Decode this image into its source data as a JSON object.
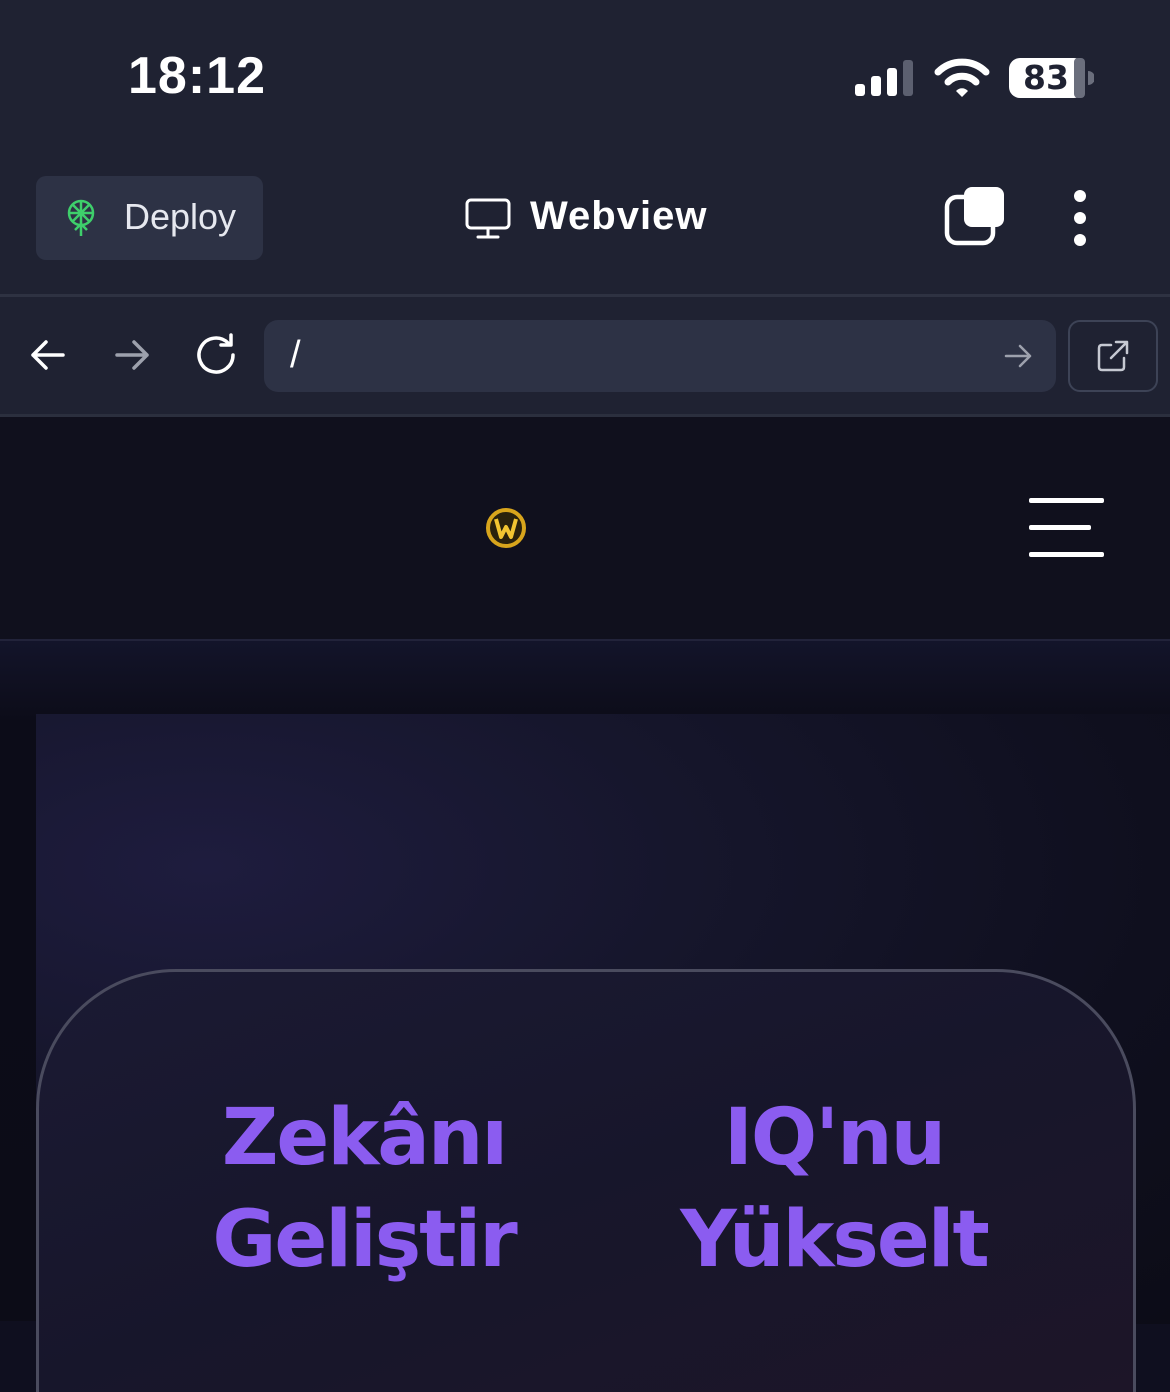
{
  "status_bar": {
    "time": "18:12",
    "battery": "83",
    "icons": [
      "cellular-signal-icon",
      "wifi-icon",
      "battery-icon"
    ]
  },
  "top_bar": {
    "deploy_label": "Deploy",
    "deploy_icon": "deploy-antenna-icon",
    "title": "Webview",
    "title_icon": "monitor-icon",
    "tabs_icon": "tabs-icon",
    "menu_icon": "more-vertical-icon",
    "accent_color": "#3ecf6b"
  },
  "nav_bar": {
    "url": "/",
    "icons": [
      "back-arrow-icon",
      "forward-arrow-icon",
      "reload-icon",
      "go-arrow-icon",
      "open-external-icon"
    ]
  },
  "site": {
    "logo_icon": "brand-logo-icon",
    "menu_icon": "hamburger-menu-icon",
    "hero": {
      "headline_left": "Zekânı Geliştir",
      "headline_right": "IQ'nu Yükselt",
      "headline_color": "#8b5cf0"
    }
  }
}
